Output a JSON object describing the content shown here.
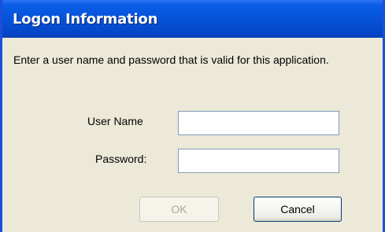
{
  "window": {
    "title": "Logon Information"
  },
  "message": "Enter a user name and password that is valid for this application.",
  "form": {
    "username_label": "User Name",
    "username_value": "",
    "password_label": "Password:",
    "password_value": ""
  },
  "buttons": {
    "ok_label": "OK",
    "ok_enabled": false,
    "cancel_label": "Cancel"
  },
  "colors": {
    "titlebar": "#0653d8",
    "dialog_face": "#ece9d8",
    "textbox_border": "#7f9db9"
  }
}
